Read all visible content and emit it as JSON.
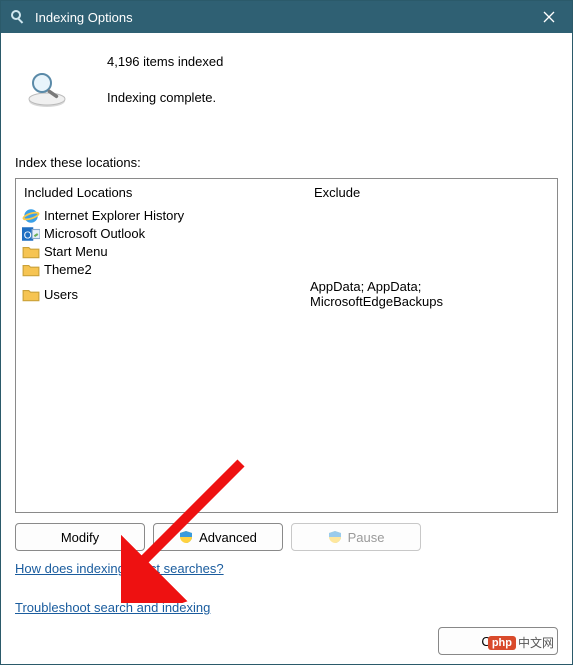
{
  "titlebar": {
    "title": "Indexing Options"
  },
  "status": {
    "items_line": "4,196 items indexed",
    "state_line": "Indexing complete."
  },
  "section_label": "Index these locations:",
  "columns": {
    "included": "Included Locations",
    "exclude": "Exclude"
  },
  "rows": [
    {
      "icon": "ie",
      "name": "Internet Explorer History",
      "exclude": ""
    },
    {
      "icon": "outlook",
      "name": "Microsoft Outlook",
      "exclude": ""
    },
    {
      "icon": "folder",
      "name": "Start Menu",
      "exclude": ""
    },
    {
      "icon": "folder",
      "name": "Theme2",
      "exclude": ""
    },
    {
      "icon": "folder",
      "name": "Users",
      "exclude": "AppData; AppData; MicrosoftEdgeBackups"
    }
  ],
  "buttons": {
    "modify": "Modify",
    "advanced": "Advanced",
    "pause": "Pause",
    "close": "Close"
  },
  "links": {
    "help": "How does indexing affect searches?",
    "troubleshoot": "Troubleshoot search and indexing"
  },
  "watermark": {
    "badge": "php",
    "text": "中文网"
  }
}
